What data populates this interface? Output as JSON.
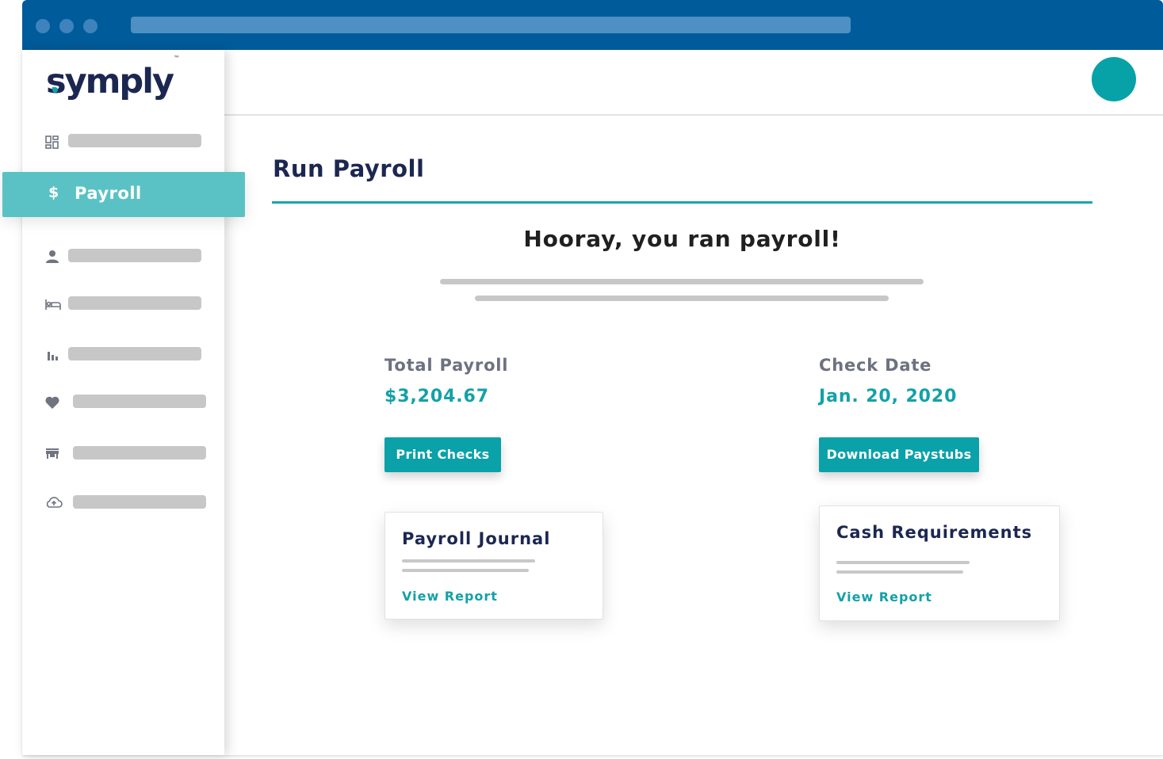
{
  "browser": {
    "window_dots": [
      "dot",
      "dot",
      "dot"
    ]
  },
  "app": {
    "logo_text": "symply",
    "logo_mark": "™"
  },
  "sidebar": {
    "items": [
      {
        "icon": "dashboard-icon",
        "label": ""
      },
      {
        "icon": "dollar-icon",
        "label": "Payroll",
        "active": true
      },
      {
        "icon": "person-icon",
        "label": ""
      },
      {
        "icon": "bed-icon",
        "label": ""
      },
      {
        "icon": "bar-chart-icon",
        "label": ""
      },
      {
        "icon": "heart-icon",
        "label": ""
      },
      {
        "icon": "store-icon",
        "label": ""
      },
      {
        "icon": "cloud-upload-icon",
        "label": ""
      }
    ],
    "active_symbol": "$"
  },
  "main": {
    "title": "Run Payroll",
    "headline": "Hooray, you ran payroll!",
    "total_payroll": {
      "label": "Total Payroll",
      "value": "$3,204.67"
    },
    "check_date": {
      "label": "Check Date",
      "value": "Jan. 20, 2020"
    },
    "buttons": {
      "print_checks": "Print Checks",
      "download_paystubs": "Download Paystubs"
    },
    "cards": [
      {
        "title": "Payroll Journal",
        "link": "View Report"
      },
      {
        "title": "Cash Requirements",
        "link": "View Report"
      }
    ]
  },
  "colors": {
    "titlebar": "#005b9a",
    "accent": "#0aa1a9",
    "active_nav": "#5ac2c4",
    "navy": "#1c2751"
  }
}
